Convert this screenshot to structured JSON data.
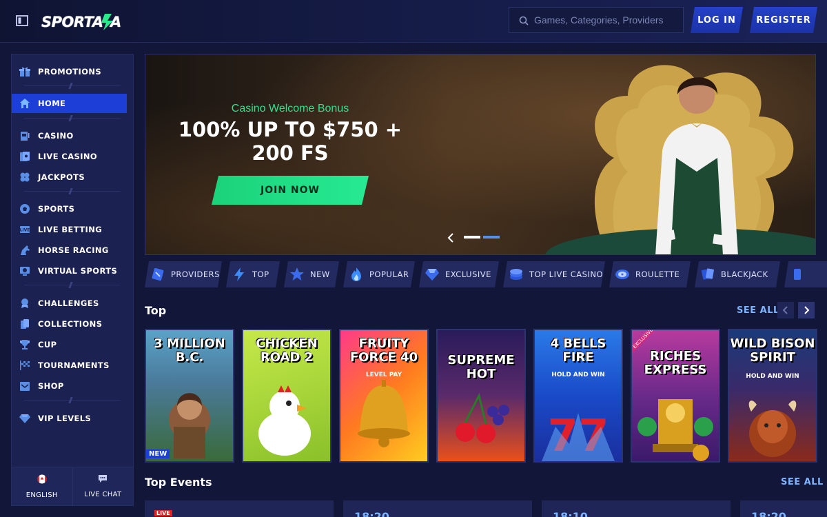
{
  "header": {
    "logo": "SPORTAZA",
    "search_placeholder": "Games, Categories, Providers",
    "login_label": "LOG IN",
    "register_label": "REGISTER"
  },
  "sidebar": {
    "items": [
      {
        "label": "PROMOTIONS",
        "icon": "gift-icon"
      },
      {
        "label": "HOME",
        "icon": "home-icon",
        "active": true
      },
      {
        "label": "CASINO",
        "icon": "slot-machine-icon"
      },
      {
        "label": "LIVE CASINO",
        "icon": "live-casino-icon"
      },
      {
        "label": "JACKPOTS",
        "icon": "clover-icon"
      },
      {
        "label": "SPORTS",
        "icon": "soccer-ball-icon"
      },
      {
        "label": "LIVE BETTING",
        "icon": "live-icon"
      },
      {
        "label": "HORSE RACING",
        "icon": "horse-icon"
      },
      {
        "label": "VIRTUAL SPORTS",
        "icon": "virtual-sports-icon"
      },
      {
        "label": "CHALLENGES",
        "icon": "medal-icon"
      },
      {
        "label": "COLLECTIONS",
        "icon": "cards-icon"
      },
      {
        "label": "CUP",
        "icon": "trophy-icon"
      },
      {
        "label": "TOURNAMENTS",
        "icon": "checkered-flag-icon"
      },
      {
        "label": "SHOP",
        "icon": "shop-icon"
      },
      {
        "label": "VIP LEVELS",
        "icon": "diamond-icon"
      }
    ],
    "language_label": "ENGLISH",
    "chat_label": "LIVE CHAT"
  },
  "hero": {
    "subtitle": "Casino Welcome Bonus",
    "title": "100% UP TO $750 + 200 FS",
    "cta": "JOIN NOW",
    "slides": 2,
    "active_slide": 2
  },
  "categories": [
    {
      "label": "PROVIDERS",
      "icon": "providers-icon"
    },
    {
      "label": "TOP",
      "icon": "lightning-icon"
    },
    {
      "label": "NEW",
      "icon": "star-icon"
    },
    {
      "label": "POPULAR",
      "icon": "flame-icon"
    },
    {
      "label": "EXCLUSIVE",
      "icon": "diamond-icon"
    },
    {
      "label": "TOP LIVE CASINO",
      "icon": "chips-icon"
    },
    {
      "label": "ROULETTE",
      "icon": "roulette-icon"
    },
    {
      "label": "BLACKJACK",
      "icon": "cards-icon"
    }
  ],
  "top_section": {
    "title": "Top",
    "see_all": "SEE ALL",
    "games": [
      {
        "title": "3 MILLION B.C.",
        "badge": "NEW",
        "colors": [
          "#5aa3c8",
          "#3a6a3a"
        ]
      },
      {
        "title": "CHICKEN ROAD 2",
        "colors": [
          "#a8d63a",
          "#6c9e1a"
        ]
      },
      {
        "title": "FRUITY FORCE 40",
        "subtitle": "LEVEL PAY",
        "colors": [
          "#ff3a8a",
          "#ffb020"
        ]
      },
      {
        "title": "SUPREME HOT",
        "colors": [
          "#2a1b5a",
          "#e8501a"
        ]
      },
      {
        "title": "4 BELLS FIRE",
        "subtitle": "HOLD AND WIN",
        "colors": [
          "#2a7ae8",
          "#1a2f9e"
        ]
      },
      {
        "title": "RICHES EXPRESS",
        "badge": "EXCLUSIVE",
        "colors": [
          "#b83a9e",
          "#3a1a6a"
        ]
      },
      {
        "title": "WILD BISON SPIRIT",
        "subtitle": "HOLD AND WIN",
        "colors": [
          "#1a3a7a",
          "#8a2a1a"
        ]
      }
    ]
  },
  "events_section": {
    "title": "Top Events",
    "see_all": "SEE ALL",
    "cards": [
      {
        "live": "LIVE"
      },
      {
        "time": "18:20"
      },
      {
        "time": "18:10"
      },
      {
        "time": "18:20"
      }
    ]
  },
  "colors": {
    "accent_green": "#26ea92",
    "accent_blue": "#1d3fd8",
    "link_blue": "#7fb4ff"
  }
}
